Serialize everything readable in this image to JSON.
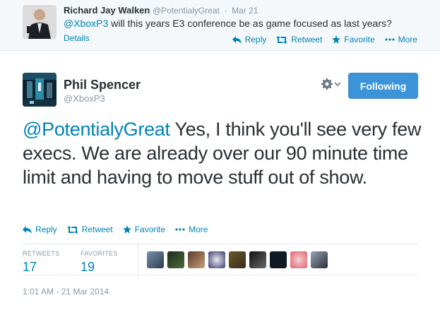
{
  "parent_tweet": {
    "name": "Richard Jay Walken",
    "handle": "@PotentialyGreat",
    "separator": "·",
    "time": "Mar 21",
    "mention": "@XboxP3",
    "text": " will this years E3 conference be as game focused as last years?",
    "details_label": "Details",
    "actions": {
      "reply": "Reply",
      "retweet": "Retweet",
      "favorite": "Favorite",
      "more": "More"
    }
  },
  "tweet": {
    "name": "Phil Spencer",
    "handle": "@XboxP3",
    "follow_label": "Following",
    "mention": "@PotentialyGreat",
    "text": " Yes, I think you'll see very few execs.  We are already over our 90 minute time limit and having to move stuff out of show.",
    "actions": {
      "reply": "Reply",
      "retweet": "Retweet",
      "favorite": "Favorite",
      "more": "More"
    },
    "stats": {
      "retweets_label": "RETWEETS",
      "retweets": "17",
      "favorites_label": "FAVORITES",
      "favorites": "19"
    },
    "timestamp": "1:01 AM - 21 Mar 2014"
  },
  "colors": {
    "link": "#0084b4",
    "muted": "#8899a6",
    "follow_button": "#3b94d9"
  },
  "icons": {
    "reply": "reply-icon",
    "retweet": "retweet-icon",
    "favorite": "star-icon",
    "more": "more-dots-icon",
    "settings": "gear-icon",
    "dropdown": "chevron-down-icon"
  }
}
